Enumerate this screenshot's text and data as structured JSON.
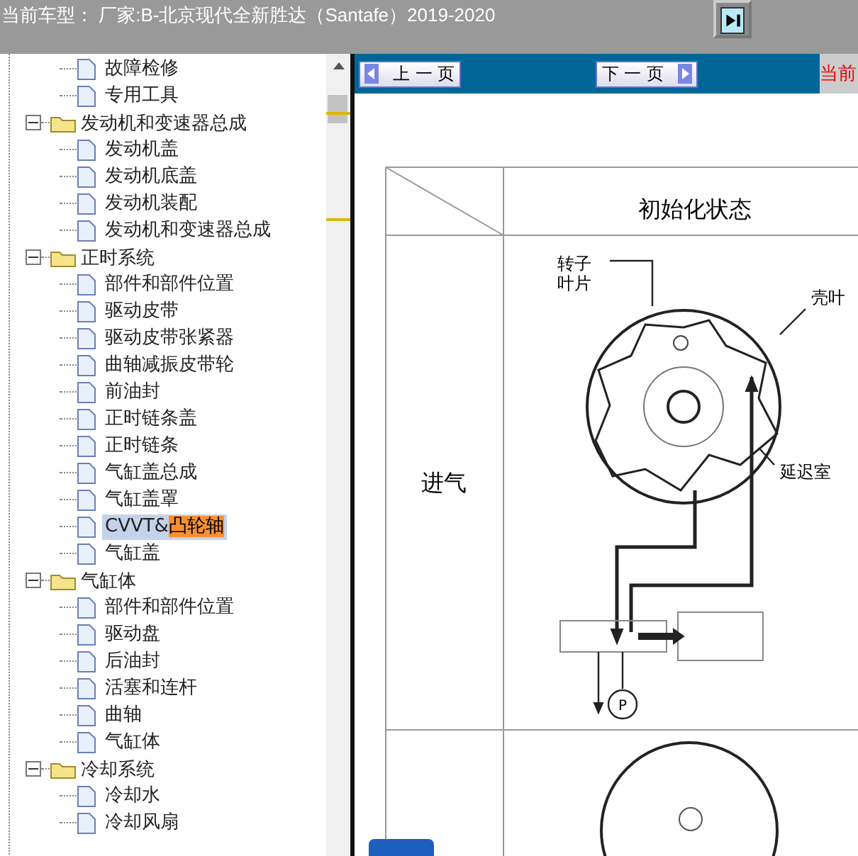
{
  "header": {
    "title": "当前车型： 厂家:B-北京现代全新胜达（Santafe）2019-2020"
  },
  "tree": {
    "orphan_items": [
      {
        "label": "故障检修",
        "selected": false
      },
      {
        "label": "专用工具",
        "selected": false
      }
    ],
    "groups": [
      {
        "label": "发动机和变速器总成",
        "expanded": true,
        "children": [
          {
            "label": "发动机盖",
            "selected": false
          },
          {
            "label": "发动机底盖",
            "selected": false
          },
          {
            "label": "发动机装配",
            "selected": false
          },
          {
            "label": "发动机和变速器总成",
            "selected": false
          }
        ]
      },
      {
        "label": "正时系统",
        "expanded": true,
        "children": [
          {
            "label": "部件和部件位置",
            "selected": false
          },
          {
            "label": "驱动皮带",
            "selected": false
          },
          {
            "label": "驱动皮带张紧器",
            "selected": false
          },
          {
            "label": "曲轴减振皮带轮",
            "selected": false
          },
          {
            "label": "前油封",
            "selected": false
          },
          {
            "label": "正时链条盖",
            "selected": false
          },
          {
            "label": "正时链条",
            "selected": false
          },
          {
            "label": "气缸盖总成",
            "selected": false
          },
          {
            "label": "气缸盖罩",
            "selected": false
          },
          {
            "label": "CVVT&",
            "match": "凸轮轴",
            "selected": true
          },
          {
            "label": "气缸盖",
            "selected": false
          }
        ]
      },
      {
        "label": "气缸体",
        "expanded": true,
        "children": [
          {
            "label": "部件和部件位置",
            "selected": false
          },
          {
            "label": "驱动盘",
            "selected": false
          },
          {
            "label": "后油封",
            "selected": false
          },
          {
            "label": "活塞和连杆",
            "selected": false
          },
          {
            "label": "曲轴",
            "selected": false
          },
          {
            "label": "气缸体",
            "selected": false
          }
        ]
      },
      {
        "label": "冷却系统",
        "expanded": true,
        "children": [
          {
            "label": "冷却水",
            "selected": false
          },
          {
            "label": "冷却风扇",
            "selected": false
          }
        ]
      }
    ]
  },
  "toolbar": {
    "prev": "上 一 页",
    "next": "下 一 页",
    "current": "当前"
  },
  "figure": {
    "header": "初始化状态",
    "row_label": "进气",
    "rotor_label": [
      "转子",
      "叶片"
    ],
    "housing_label": "壳叶",
    "chamber_label": "延迟室",
    "pump_label": "P"
  }
}
